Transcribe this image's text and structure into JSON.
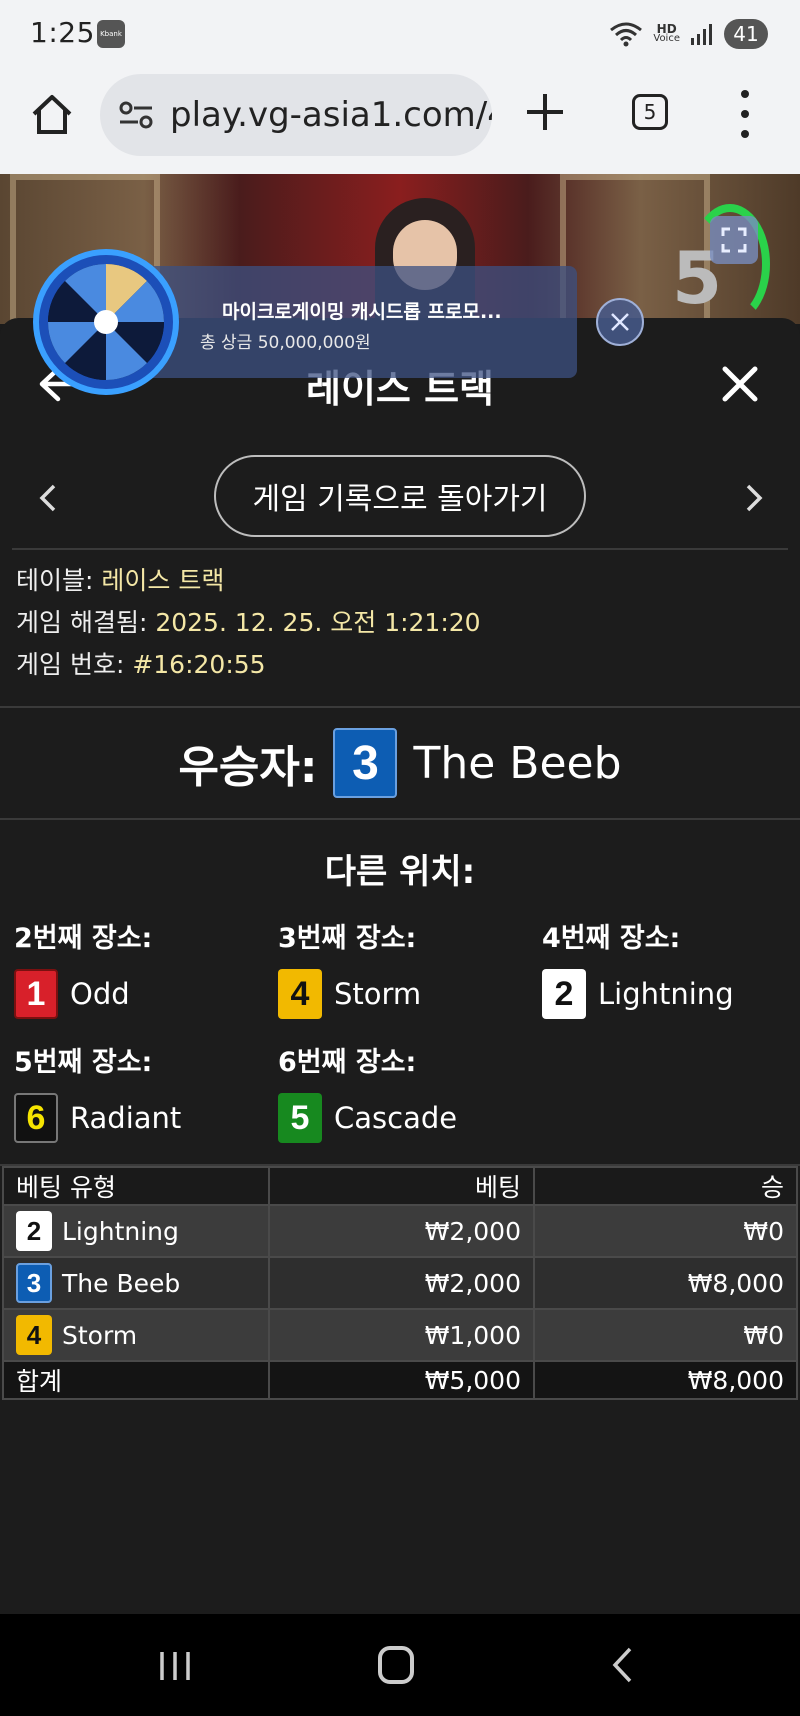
{
  "status_bar": {
    "time": "1:25",
    "app_badge": "Kbank",
    "hd_label": "HD",
    "voice_label": "Voice",
    "battery": "41"
  },
  "browser": {
    "url": "play.vg-asia1.com/4",
    "tab_count": "5"
  },
  "video": {
    "countdown": "5"
  },
  "promo": {
    "headline": "마이크로게이밍 캐시드롭 프로모...",
    "prize": "총 상금 50,000,000원"
  },
  "panel": {
    "title": "레이스 트랙",
    "back_to_history": "게임 기록으로 돌아가기",
    "info": [
      {
        "key": "테이블: ",
        "value": "레이스 트랙"
      },
      {
        "key": "게임 해결됨: ",
        "value": "2025. 12. 25. 오전 1:21:20"
      },
      {
        "key": "게임 번호: ",
        "value": "#16:20:55"
      }
    ],
    "winner": {
      "label": "우승자:",
      "number": "3",
      "name": "The Beeb",
      "color": "#0d5db3"
    },
    "others_title": "다른 위치:",
    "places": [
      {
        "label": "2번째 장소:",
        "number": "1",
        "name": "Odd",
        "color": "#d8202a",
        "text_color": "#ffffff"
      },
      {
        "label": "3번째 장소:",
        "number": "4",
        "name": "Storm",
        "color": "#f2b900",
        "text_color": "#111111"
      },
      {
        "label": "4번째 장소:",
        "number": "2",
        "name": "Lightning",
        "color": "#ffffff",
        "text_color": "#111111"
      },
      {
        "label": "5번째 장소:",
        "number": "6",
        "name": "Radiant",
        "color": "#111111",
        "text_color": "#f5e400"
      },
      {
        "label": "6번째 장소:",
        "number": "5",
        "name": "Cascade",
        "color": "#17891f",
        "text_color": "#ffffff"
      }
    ],
    "table": {
      "headers": [
        "베팅 유형",
        "베팅",
        "승"
      ],
      "rows": [
        {
          "number": "2",
          "name": "Lightning",
          "color": "#ffffff",
          "text_color": "#111111",
          "bet": "₩2,000",
          "win": "₩0"
        },
        {
          "number": "3",
          "name": "The Beeb",
          "color": "#0d5db3",
          "text_color": "#ffffff",
          "bet": "₩2,000",
          "win": "₩8,000"
        },
        {
          "number": "4",
          "name": "Storm",
          "color": "#f2b900",
          "text_color": "#111111",
          "bet": "₩1,000",
          "win": "₩0"
        }
      ],
      "total": {
        "label": "합계",
        "bet": "₩5,000",
        "win": "₩8,000"
      }
    }
  },
  "icons": [
    "home-icon",
    "tune-icon",
    "new-tab-icon",
    "tab-switcher-icon",
    "more-menu-icon",
    "expand-icon",
    "back-arrow-icon",
    "close-icon",
    "chevron-left-icon",
    "chevron-right-icon"
  ]
}
